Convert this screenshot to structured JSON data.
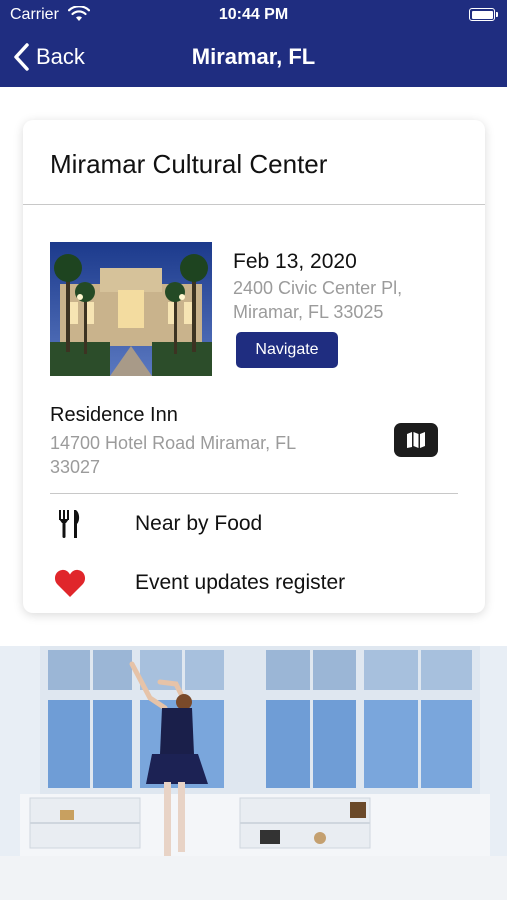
{
  "status_bar": {
    "carrier": "Carrier",
    "time": "10:44 PM"
  },
  "nav": {
    "back_label": "Back",
    "title": "Miramar, FL"
  },
  "card": {
    "title": "Miramar Cultural Center",
    "event": {
      "date": "Feb 13, 2020",
      "address_line1": "2400 Civic Center Pl,",
      "address_line2": "Miramar, FL 33025",
      "navigate_label": "Navigate"
    },
    "hotel": {
      "name": "Residence Inn",
      "address_line1": "14700 Hotel Road Miramar, FL",
      "address_line2": "33027"
    },
    "actions": [
      {
        "label": "Near by Food",
        "icon": "fork-knife-icon"
      },
      {
        "label": "Event updates register",
        "icon": "heart-icon"
      }
    ]
  },
  "colors": {
    "brand_navy": "#1f2d80",
    "heart_red": "#e0262b",
    "muted_text": "#9b9b9b"
  }
}
